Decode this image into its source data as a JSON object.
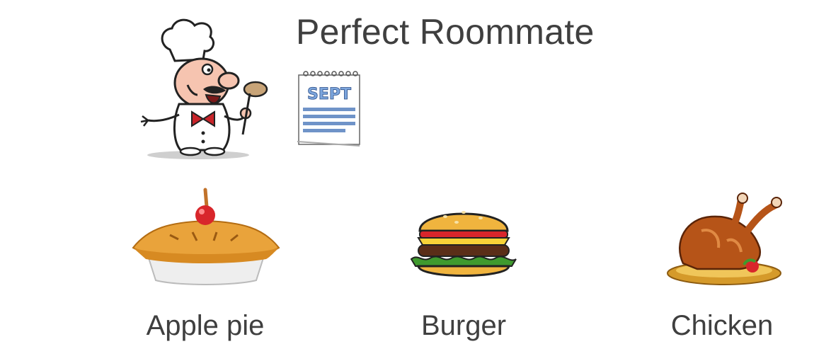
{
  "title": "Perfect Roommate",
  "calendar_label": "SEPT",
  "foods": [
    {
      "label": "Apple pie",
      "icon": "apple-pie-icon"
    },
    {
      "label": "Burger",
      "icon": "burger-icon"
    },
    {
      "label": "Chicken",
      "icon": "roast-chicken-icon"
    }
  ],
  "colors": {
    "text": "#3f3f3f",
    "crust": "#e9a33b",
    "cherry": "#d8262b",
    "bun": "#f0b43e",
    "lettuce": "#3f9a2e",
    "chicken": "#b65418"
  }
}
